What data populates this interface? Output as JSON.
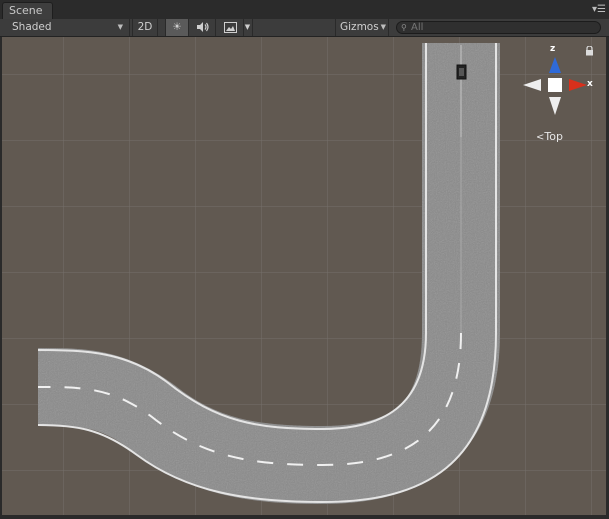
{
  "window": {
    "tab_label": "Scene",
    "tab_menu_icon": "menu-lines-icon"
  },
  "toolbar": {
    "draw_mode": "Shaded",
    "dimension_toggle": "2D",
    "lighting_icon": "sun-icon",
    "audio_icon": "speaker-icon",
    "effects_icon": "image-icon",
    "gizmos": "Gizmos",
    "search_placeholder": "All"
  },
  "gizmo": {
    "z_label": "z",
    "x_label": "x",
    "view_label": "Top",
    "lock_icon": "lock-icon",
    "colors": {
      "z_axis": "#2f6ad8",
      "x_axis": "#d8301c",
      "neutral": "#ffffff"
    }
  },
  "scene": {
    "background_color": "#605850",
    "grid_color": "#77716b",
    "road_color": "#8e8e8e"
  }
}
